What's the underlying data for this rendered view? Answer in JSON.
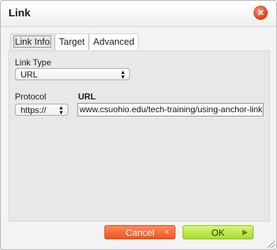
{
  "dialog": {
    "title": "Link",
    "close_icon": "close-icon",
    "tabs": [
      {
        "label": "Link Info",
        "active": true
      },
      {
        "label": "Target",
        "active": false
      },
      {
        "label": "Advanced",
        "active": false
      }
    ],
    "link_type": {
      "label": "Link Type",
      "value": "URL"
    },
    "protocol": {
      "label": "Protocol",
      "value": "https://"
    },
    "url": {
      "label": "URL",
      "value": "www.csuohio.edu/tech-training/using-anchor-links"
    },
    "buttons": {
      "cancel": "Cancel",
      "ok": "OK"
    },
    "colors": {
      "cancel": "#f0551e",
      "ok": "#a9dc2a",
      "close": "#e7461d"
    }
  }
}
